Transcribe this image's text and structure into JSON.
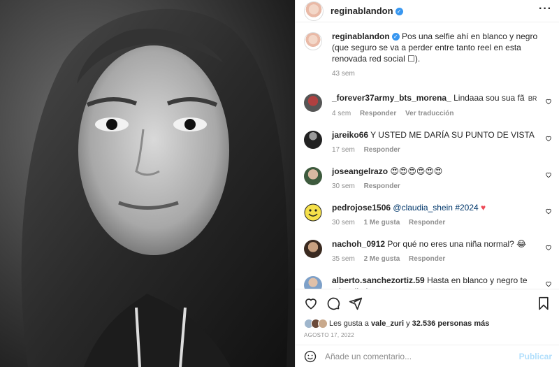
{
  "post": {
    "username": "reginablandon",
    "caption": "Pos una selfie ahí en blanco y negro (que seguro se va a perder entre tanto reel en esta renovada red social ☐).",
    "caption_time": "43 sem"
  },
  "comments": [
    {
      "user": "_forever37army_bts_morena_",
      "text": "Lindaaa sou sua fã",
      "flag": "BR",
      "time": "4 sem",
      "reply": "Responder",
      "translate": "Ver traducción",
      "likes": ""
    },
    {
      "user": "jareiko66",
      "text": "Y USTED ME DARÍA SU PUNTO DE VISTA",
      "time": "17 sem",
      "reply": "Responder",
      "likes": ""
    },
    {
      "user": "joseangelrazo",
      "text": "😍😍😍😍😍😍",
      "time": "30 sem",
      "reply": "Responder",
      "likes": ""
    },
    {
      "user": "pedrojose1506",
      "mention": "@claudia_shein",
      "hashtag": "#2024",
      "text": "♥",
      "time": "30 sem",
      "likes": "1 Me gusta",
      "reply": "Responder"
    },
    {
      "user": "nachoh_0912",
      "text": "Por qué no eres una niña normal? 😂",
      "time": "35 sem",
      "likes": "2 Me gusta",
      "reply": "Responder"
    },
    {
      "user": "alberto.sanchezortiz.59",
      "text": "Hasta en blanco y negro te miras linda"
    }
  ],
  "likes": {
    "prefix": "Les gusta a",
    "user": "vale_zuri",
    "mid": "y",
    "count": "32.536 personas más"
  },
  "date": "AGOSTO 17, 2022",
  "composer": {
    "placeholder": "Añade un comentario...",
    "publish": "Publicar"
  },
  "colors": {
    "verified": "#3897f0",
    "link": "#00376b",
    "heart_red": "#ed4956"
  },
  "icons": [
    "more-icon",
    "heart-icon",
    "comment-icon",
    "share-icon",
    "bookmark-icon",
    "emoji-icon"
  ]
}
